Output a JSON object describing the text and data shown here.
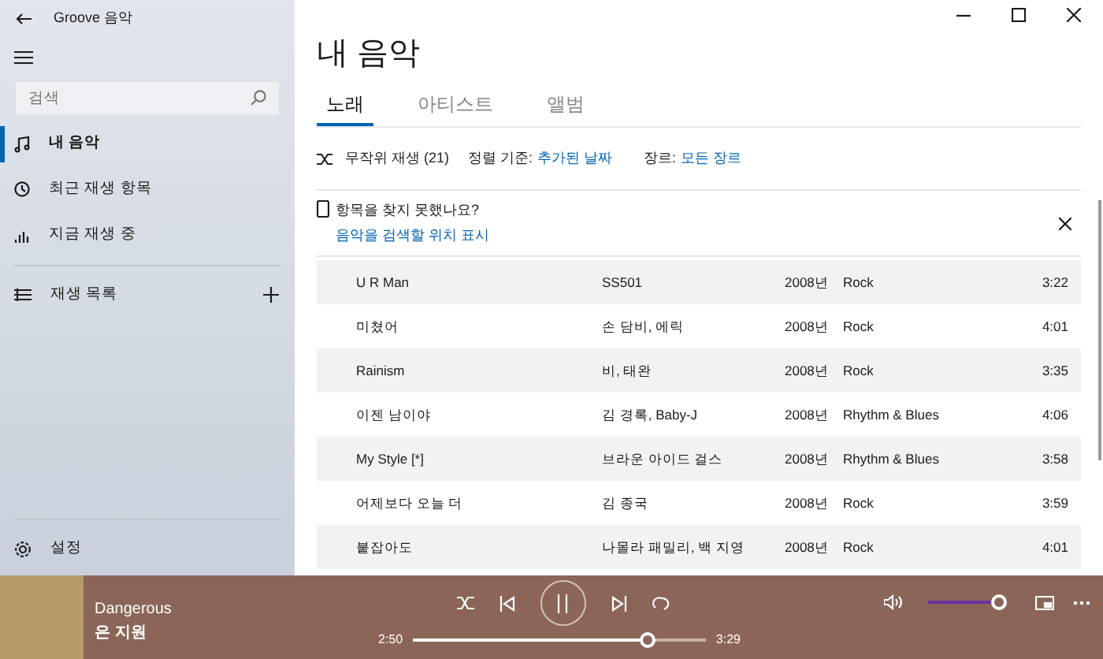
{
  "window": {
    "title": "Groove 음악"
  },
  "sidebar": {
    "search": {
      "placeholder": "검색"
    },
    "items": [
      {
        "kind": "music",
        "label": "내 음악",
        "selected": true
      },
      {
        "kind": "recent",
        "label": "최근 재생 항목",
        "selected": false
      },
      {
        "kind": "nowplaying",
        "label": "지금 재생 중",
        "selected": false
      }
    ],
    "playlists": {
      "label": "재생 목록"
    },
    "settings": {
      "label": "설정"
    }
  },
  "main": {
    "title": "내 음악",
    "tabs": [
      {
        "label": "노래",
        "selected": true
      },
      {
        "label": "아티스트",
        "selected": false
      },
      {
        "label": "앨범",
        "selected": false
      }
    ],
    "toolbar": {
      "shuffle": "무작위 재생 (21)",
      "sort_label": "정렬 기준:",
      "sort_value": "추가된 날짜",
      "genre_label": "장르:",
      "genre_value": "모든 장르"
    },
    "notice": {
      "text": "항목을 찾지 못했나요?",
      "link": "음악을 검색할 위치 표시"
    },
    "songs": [
      {
        "title": "U R Man",
        "artist": "SS501",
        "year": "2008년",
        "genre": "Rock",
        "duration": "3:22"
      },
      {
        "title": "미쳤어",
        "artist": "손 담비, 에릭",
        "year": "2008년",
        "genre": "Rock",
        "duration": "4:01"
      },
      {
        "title": "Rainism",
        "artist": "비, 태완",
        "year": "2008년",
        "genre": "Rock",
        "duration": "3:35"
      },
      {
        "title": "이젠 남이야",
        "artist": "김 경록, Baby-J",
        "year": "2008년",
        "genre": "Rhythm & Blues",
        "duration": "4:06"
      },
      {
        "title": "My Style [*]",
        "artist": "브라운 아이드 걸스",
        "year": "2008년",
        "genre": "Rhythm & Blues",
        "duration": "3:58"
      },
      {
        "title": "어제보다 오늘 더",
        "artist": "김 종국",
        "year": "2008년",
        "genre": "Rock",
        "duration": "3:59"
      },
      {
        "title": "붙잡아도",
        "artist": "나몰라 패밀리, 백 지영",
        "year": "2008년",
        "genre": "Rock",
        "duration": "4:01"
      }
    ]
  },
  "player": {
    "title": "Dangerous",
    "artist": "은 지원",
    "playing": true,
    "elapsed": "2:50",
    "total": "3:29",
    "level": 0.8,
    "volume": {
      "level": 1
    }
  }
}
